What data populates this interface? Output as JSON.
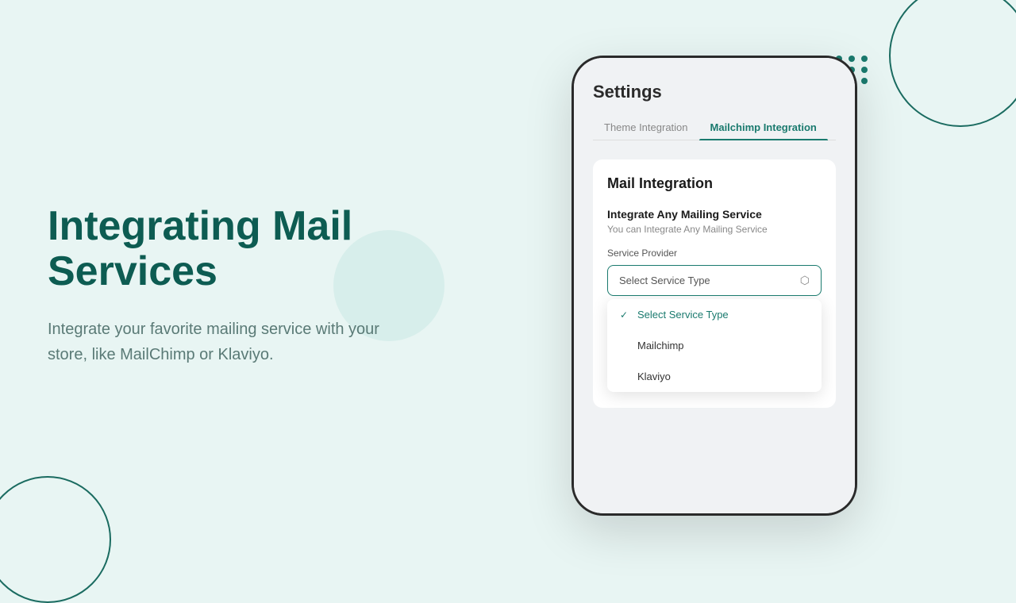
{
  "background_color": "#e8f5f3",
  "left": {
    "heading_line1": "Integrating Mail",
    "heading_line2": "Services",
    "description": "Integrate your favorite mailing service with your store, like MailChimp or Klaviyo."
  },
  "phone": {
    "settings_title": "Settings",
    "tabs": [
      {
        "label": "Theme Integration",
        "active": false
      },
      {
        "label": "Mailchimp Integration",
        "active": true
      }
    ],
    "mail_integration": {
      "title": "Mail Integration",
      "card": {
        "heading": "Integrate Any Mailing Service",
        "subtext": "You can Integrate Any Mailing Service",
        "service_provider_label": "Service Provider",
        "select_placeholder": "Select Service Type",
        "dropdown_options": [
          {
            "label": "Select Service Type",
            "selected": true
          },
          {
            "label": "Mailchimp",
            "selected": false
          },
          {
            "label": "Klaviyo",
            "selected": false
          }
        ]
      }
    }
  },
  "decorative": {
    "dot_color": "#1a7a6e",
    "circle_color": "#1a6b60"
  }
}
